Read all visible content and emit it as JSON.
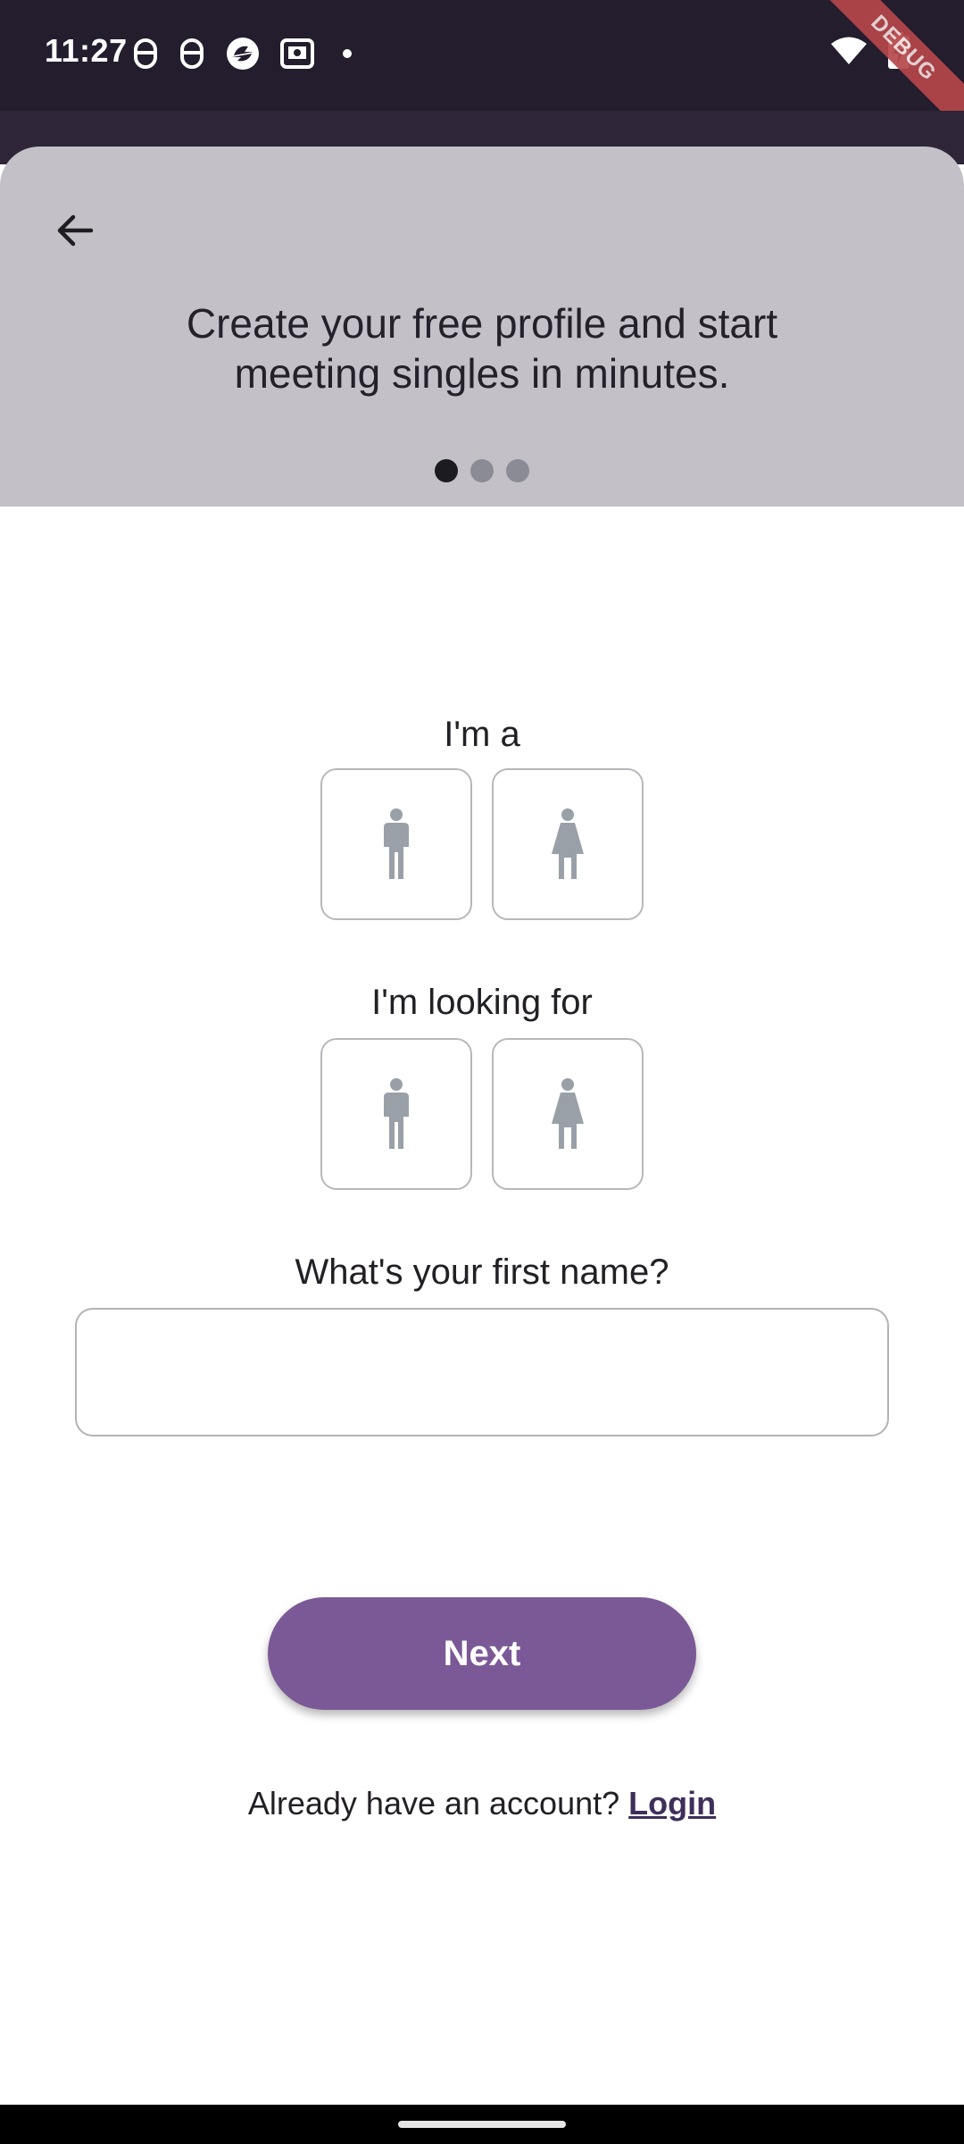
{
  "status_bar": {
    "time": "11:27",
    "icons": [
      "app-notification-icon",
      "app-notification-icon",
      "sync-icon",
      "photo-icon",
      "dot-icon",
      "wifi-icon",
      "battery-charging-icon"
    ],
    "debug_label": "DEBUG"
  },
  "header": {
    "back_icon": "arrow-left-icon",
    "title": "Create your free profile and start meeting singles in minutes.",
    "page_indicator": {
      "total": 3,
      "active": 1
    }
  },
  "form": {
    "gender_label": "I'm a",
    "gender_options": [
      {
        "icon": "male-person-icon",
        "selected": false
      },
      {
        "icon": "female-person-icon",
        "selected": false
      }
    ],
    "looking_for_label": "I'm looking for",
    "looking_for_options": [
      {
        "icon": "male-person-icon",
        "selected": false
      },
      {
        "icon": "female-person-icon",
        "selected": false
      }
    ],
    "first_name_label": "What's your first name?",
    "first_name_value": "",
    "first_name_placeholder": ""
  },
  "actions": {
    "next_label": "Next",
    "account_prompt": "Already have an account?",
    "login_label": "Login"
  },
  "colors": {
    "status_bar_bg": "#231d2d",
    "header_bg": "#c4c0c7",
    "primary_button": "#7b5996",
    "link": "#3f2f5a",
    "icon_gray": "#9aa0a8"
  }
}
